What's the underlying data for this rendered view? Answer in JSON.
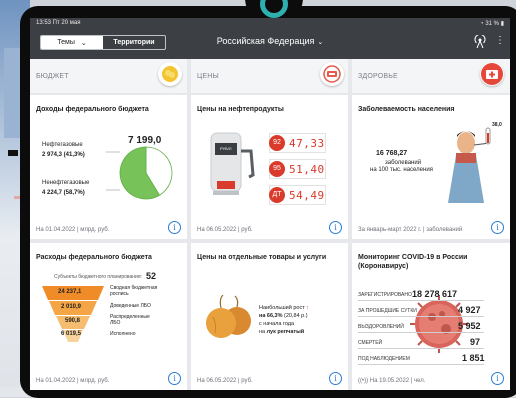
{
  "status": {
    "time_date": "13:53 Пт 20 мая",
    "battery": "31 %"
  },
  "header": {
    "seg_topics": "Темы",
    "seg_territories": "Территории",
    "region": "Российская Федерация"
  },
  "columns": [
    {
      "title": "БЮДЖЕТ",
      "icon": "coins-icon",
      "color": "#f4c430"
    },
    {
      "title": "ЦЕНЫ",
      "icon": "price-tag-icon",
      "color": "#e55a4a"
    },
    {
      "title": "ЗДОРОВЬЕ",
      "icon": "first-aid-icon",
      "color": "#e5473b"
    }
  ],
  "budget_revenue": {
    "title": "Доходы федерального бюджета",
    "total": "7 199,0",
    "oil_gas_label": "Нефтегазовые",
    "oil_gas_value": "2 974,3 (41,3%)",
    "non_oil_label": "Ненефтегазовые",
    "non_oil_value": "4 224,7 (58,7%)",
    "footer": "На 01.04.2022 | млрд. руб.",
    "chart_data": {
      "type": "pie",
      "categories": [
        "Нефтегазовые",
        "Ненефтегазовые"
      ],
      "values": [
        2974.3,
        4224.7
      ],
      "colors": [
        "#ffffff",
        "#77c35a"
      ]
    }
  },
  "budget_expenses": {
    "title": "Расходы федерального бюджета",
    "subjects_label": "Субъекты бюджетного планирования:",
    "subjects_value": "52",
    "levels": [
      {
        "value": "24 237,1",
        "label": "Сводная бюджетная роспись"
      },
      {
        "value": "2 010,9",
        "label": "Доведенные ЛБО"
      },
      {
        "value": "590,8",
        "label": "Распределенные ЛБО"
      },
      {
        "value": "6 019,5",
        "label": "Исполнено"
      }
    ],
    "footer": "На 01.04.2022 | млрд. руб."
  },
  "fuel_prices": {
    "title": "Цены на нефтепродукты",
    "pump_label": "РУБ/Л",
    "items": [
      {
        "grade": "92",
        "price": "47,33"
      },
      {
        "grade": "95",
        "price": "51,40"
      },
      {
        "grade": "ДТ",
        "price": "54,49"
      }
    ],
    "footer": "На 06.05.2022 | руб."
  },
  "goods_prices": {
    "title": "Цены на отдельные товары и услуги",
    "line1": "Наибольший рост",
    "line2_bold": "на 66,3%",
    "line2_rest": "(20,84 р.)",
    "line3": "с начала года",
    "line4_prefix": "на",
    "line4_bold": "лук репчатый",
    "footer": "На 06.05.2022 | руб."
  },
  "morbidity": {
    "title": "Заболеваемость населения",
    "temp": "38,0",
    "value": "16 768,27",
    "caption1": "заболеваний",
    "caption2": "на 100 тыс. населения",
    "footer": "За январь-март 2022 г. | заболеваний"
  },
  "covid": {
    "title": "Мониторинг COVID-19 в России (Коронавирус)",
    "rows": [
      {
        "label": "ЗАРЕГИСТРИРОВАНО",
        "value": "18 278 617"
      },
      {
        "label": "ЗА ПРОШЕДШИЕ СУТКИ",
        "value": "4 927"
      },
      {
        "label": "ВЫЗДОРОВЛЕНИЙ",
        "value": "5 952"
      },
      {
        "label": "СМЕРТЕЙ",
        "value": "97"
      },
      {
        "label": "ПОД НАБЛЮДЕНИЕМ",
        "value": "1 851"
      }
    ],
    "footer": "На 19.05.2022 | чел."
  }
}
